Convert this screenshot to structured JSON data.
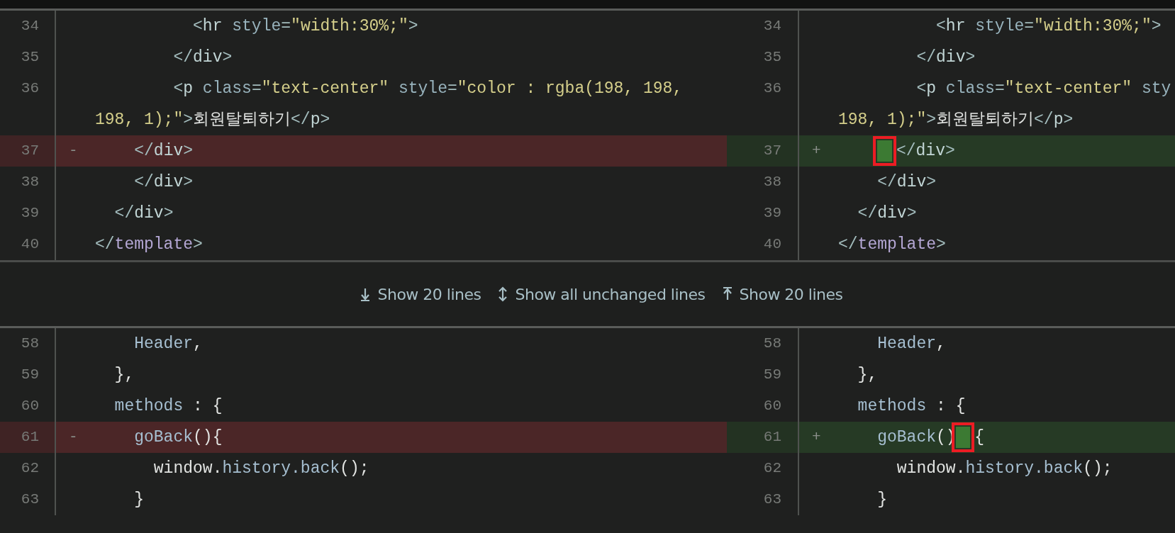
{
  "hunks": [
    {
      "rows": [
        {
          "left": {
            "number": "34",
            "lines": [
              [
                {
                  "text": "          <",
                  "kind": "punct"
                },
                {
                  "text": "hr",
                  "kind": "tag"
                },
                {
                  "text": " style",
                  "kind": "attr"
                },
                {
                  "text": "=",
                  "kind": "punct"
                },
                {
                  "text": "\"width:30%;\"",
                  "kind": "str"
                },
                {
                  "text": ">",
                  "kind": "punct"
                }
              ]
            ]
          },
          "right": {
            "number": "34",
            "lines": [
              [
                {
                  "text": "          <",
                  "kind": "punct"
                },
                {
                  "text": "hr",
                  "kind": "tag"
                },
                {
                  "text": " style",
                  "kind": "attr"
                },
                {
                  "text": "=",
                  "kind": "punct"
                },
                {
                  "text": "\"width:30%;\"",
                  "kind": "str"
                },
                {
                  "text": ">",
                  "kind": "punct"
                }
              ]
            ]
          }
        },
        {
          "left": {
            "number": "35",
            "lines": [
              [
                {
                  "text": "        </",
                  "kind": "punct"
                },
                {
                  "text": "div",
                  "kind": "tag"
                },
                {
                  "text": ">",
                  "kind": "punct"
                }
              ]
            ]
          },
          "right": {
            "number": "35",
            "lines": [
              [
                {
                  "text": "        </",
                  "kind": "punct"
                },
                {
                  "text": "div",
                  "kind": "tag"
                },
                {
                  "text": ">",
                  "kind": "punct"
                }
              ]
            ]
          }
        },
        {
          "left": {
            "number": "36",
            "lines": [
              [
                {
                  "text": "        <",
                  "kind": "punct"
                },
                {
                  "text": "p",
                  "kind": "tag"
                },
                {
                  "text": " class",
                  "kind": "attr"
                },
                {
                  "text": "=",
                  "kind": "punct"
                },
                {
                  "text": "\"text-center\"",
                  "kind": "str"
                },
                {
                  "text": " style",
                  "kind": "attr"
                },
                {
                  "text": "=",
                  "kind": "punct"
                },
                {
                  "text": "\"color : rgba(198, 198,",
                  "kind": "str"
                }
              ],
              [
                {
                  "text": "198, 1);\"",
                  "kind": "str"
                },
                {
                  "text": ">",
                  "kind": "punct"
                },
                {
                  "text": "회원탈퇴하기",
                  "kind": "text"
                },
                {
                  "text": "</",
                  "kind": "punct"
                },
                {
                  "text": "p",
                  "kind": "tag"
                },
                {
                  "text": ">",
                  "kind": "punct"
                }
              ]
            ]
          },
          "right": {
            "number": "36",
            "lines": [
              [
                {
                  "text": "        <",
                  "kind": "punct"
                },
                {
                  "text": "p",
                  "kind": "tag"
                },
                {
                  "text": " class",
                  "kind": "attr"
                },
                {
                  "text": "=",
                  "kind": "punct"
                },
                {
                  "text": "\"text-center\"",
                  "kind": "str"
                },
                {
                  "text": " sty",
                  "kind": "attr"
                }
              ],
              [
                {
                  "text": "198, 1);\"",
                  "kind": "str"
                },
                {
                  "text": ">",
                  "kind": "punct"
                },
                {
                  "text": "회원탈퇴하기",
                  "kind": "text"
                },
                {
                  "text": "</",
                  "kind": "punct"
                },
                {
                  "text": "p",
                  "kind": "tag"
                },
                {
                  "text": ">",
                  "kind": "punct"
                }
              ]
            ]
          }
        },
        {
          "left": {
            "number": "37",
            "deleted": true,
            "sign": "-",
            "lines": [
              [
                {
                  "text": "    </",
                  "kind": "punct"
                },
                {
                  "text": "div",
                  "kind": "tag"
                },
                {
                  "text": ">",
                  "kind": "punct"
                }
              ]
            ]
          },
          "right": {
            "number": "37",
            "added": true,
            "sign": "+",
            "lines": [
              [
                {
                  "text": "    </",
                  "kind": "punct",
                  "space_added_before": true,
                  "annotated": true
                },
                {
                  "text": "div",
                  "kind": "tag"
                },
                {
                  "text": ">",
                  "kind": "punct"
                }
              ]
            ]
          }
        },
        {
          "left": {
            "number": "38",
            "lines": [
              [
                {
                  "text": "    </",
                  "kind": "punct"
                },
                {
                  "text": "div",
                  "kind": "tag"
                },
                {
                  "text": ">",
                  "kind": "punct"
                }
              ]
            ]
          },
          "right": {
            "number": "38",
            "lines": [
              [
                {
                  "text": "    </",
                  "kind": "punct"
                },
                {
                  "text": "div",
                  "kind": "tag"
                },
                {
                  "text": ">",
                  "kind": "punct"
                }
              ]
            ]
          }
        },
        {
          "left": {
            "number": "39",
            "lines": [
              [
                {
                  "text": "  </",
                  "kind": "punct"
                },
                {
                  "text": "div",
                  "kind": "tag"
                },
                {
                  "text": ">",
                  "kind": "punct"
                }
              ]
            ]
          },
          "right": {
            "number": "39",
            "lines": [
              [
                {
                  "text": "  </",
                  "kind": "punct"
                },
                {
                  "text": "div",
                  "kind": "tag"
                },
                {
                  "text": ">",
                  "kind": "punct"
                }
              ]
            ]
          }
        },
        {
          "left": {
            "number": "40",
            "lines": [
              [
                {
                  "text": "</",
                  "kind": "punct"
                },
                {
                  "text": "template",
                  "kind": "keyword"
                },
                {
                  "text": ">",
                  "kind": "punct"
                }
              ]
            ]
          },
          "right": {
            "number": "40",
            "lines": [
              [
                {
                  "text": "</",
                  "kind": "punct"
                },
                {
                  "text": "template",
                  "kind": "keyword"
                },
                {
                  "text": ">",
                  "kind": "punct"
                }
              ]
            ]
          }
        }
      ]
    },
    {
      "rows": [
        {
          "left": {
            "number": "58",
            "lines": [
              [
                {
                  "text": "    Header",
                  "kind": "ident"
                },
                {
                  "text": ",",
                  "kind": "text"
                }
              ]
            ]
          },
          "right": {
            "number": "58",
            "lines": [
              [
                {
                  "text": "    Header",
                  "kind": "ident"
                },
                {
                  "text": ",",
                  "kind": "text"
                }
              ]
            ]
          }
        },
        {
          "left": {
            "number": "59",
            "lines": [
              [
                {
                  "text": "  },",
                  "kind": "text"
                }
              ]
            ]
          },
          "right": {
            "number": "59",
            "lines": [
              [
                {
                  "text": "  },",
                  "kind": "text"
                }
              ]
            ]
          }
        },
        {
          "left": {
            "number": "60",
            "lines": [
              [
                {
                  "text": "  methods",
                  "kind": "ident"
                },
                {
                  "text": " : {",
                  "kind": "text"
                }
              ]
            ]
          },
          "right": {
            "number": "60",
            "lines": [
              [
                {
                  "text": "  methods",
                  "kind": "ident"
                },
                {
                  "text": " : {",
                  "kind": "text"
                }
              ]
            ]
          }
        },
        {
          "left": {
            "number": "61",
            "deleted": true,
            "sign": "-",
            "lines": [
              [
                {
                  "text": "    goBack",
                  "kind": "ident"
                },
                {
                  "text": "(){",
                  "kind": "text"
                }
              ]
            ]
          },
          "right": {
            "number": "61",
            "added": true,
            "sign": "+",
            "lines": [
              [
                {
                  "text": "    goBack",
                  "kind": "ident"
                },
                {
                  "text": "()",
                  "kind": "text"
                },
                {
                  "text": "{",
                  "kind": "text",
                  "space_added_before": true,
                  "annotated": true
                }
              ]
            ]
          }
        },
        {
          "left": {
            "number": "62",
            "lines": [
              [
                {
                  "text": "      window.",
                  "kind": "text"
                },
                {
                  "text": "history",
                  "kind": "ident"
                },
                {
                  "text": ".back",
                  "kind": "ident"
                },
                {
                  "text": "();",
                  "kind": "text"
                }
              ]
            ]
          },
          "right": {
            "number": "62",
            "lines": [
              [
                {
                  "text": "      window.",
                  "kind": "text"
                },
                {
                  "text": "history",
                  "kind": "ident"
                },
                {
                  "text": ".back",
                  "kind": "ident"
                },
                {
                  "text": "();",
                  "kind": "text"
                }
              ]
            ]
          }
        },
        {
          "left": {
            "number": "63",
            "lines": [
              [
                {
                  "text": "    }",
                  "kind": "text"
                }
              ]
            ]
          },
          "right": {
            "number": "63",
            "lines": [
              [
                {
                  "text": "    }",
                  "kind": "text"
                }
              ]
            ]
          }
        }
      ]
    }
  ],
  "expanders": [
    {
      "label": "Show 20 lines",
      "kind": "down"
    },
    {
      "label": "Show all unchanged lines",
      "kind": "both"
    },
    {
      "label": "Show 20 lines",
      "kind": "up"
    }
  ]
}
